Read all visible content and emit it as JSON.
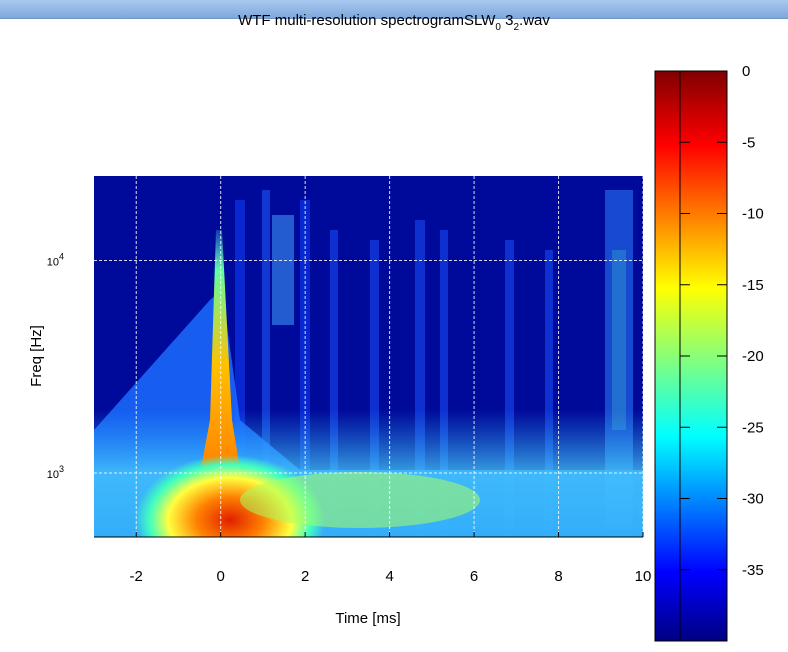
{
  "window": {
    "title": ""
  },
  "chart_data": {
    "type": "heatmap",
    "title_main": "WTF multi-resolution spectrogramSLW",
    "title_sub0": "0",
    "title_mid": "3",
    "title_sub2": "2",
    "title_end": ".wav",
    "xlabel": "Time [ms]",
    "ylabel": "Freq [Hz]",
    "xlim": [
      -3,
      10
    ],
    "ylim": [
      500,
      25000
    ],
    "yscale": "log",
    "grid": true,
    "x_ticks": [
      -2,
      0,
      2,
      4,
      6,
      8,
      10
    ],
    "x_tick_labels": [
      "-2",
      "0",
      "2",
      "4",
      "6",
      "8",
      "10"
    ],
    "y_ticks": [
      1000,
      10000
    ],
    "y_tick_labels": [
      {
        "base": "10",
        "exp": "3"
      },
      {
        "base": "10",
        "exp": "4"
      }
    ],
    "colorbar": {
      "colormap": "jet",
      "range": [
        -40,
        0
      ],
      "ticks": [
        0,
        -5,
        -10,
        -15,
        -20,
        -25,
        -30,
        -35
      ],
      "tick_labels": [
        "0",
        "-5",
        "-10",
        "-15",
        "-20",
        "-25",
        "-30",
        "-35"
      ]
    }
  }
}
